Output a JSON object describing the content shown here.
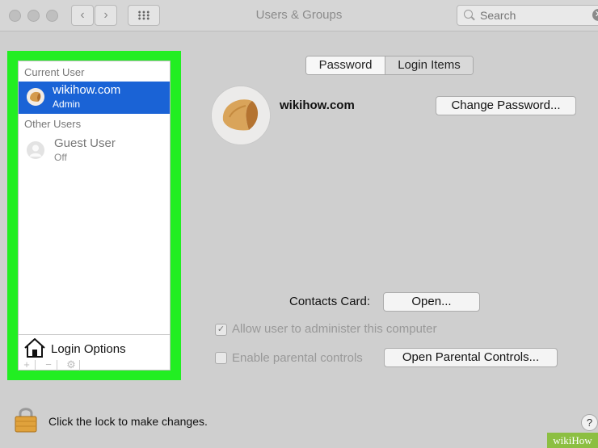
{
  "window": {
    "title": "Users & Groups"
  },
  "toolbar": {
    "back_glyph": "‹",
    "forward_glyph": "›",
    "grid_icon": "show-all-icon"
  },
  "search": {
    "placeholder": "Search",
    "clear_glyph": "✕"
  },
  "sidebar": {
    "current_heading": "Current User",
    "current_user": {
      "name": "wikihow.com",
      "role": "Admin"
    },
    "other_heading": "Other Users",
    "guest_user": {
      "name": "Guest User",
      "status": "Off"
    },
    "login_options_label": "Login Options",
    "tools": {
      "add": "+",
      "remove": "−",
      "gear": "⚙"
    },
    "highlight_color": "#22ee22"
  },
  "tabs": {
    "password": "Password",
    "login_items": "Login Items",
    "selected": "Login Items"
  },
  "account": {
    "name": "wikihow.com",
    "change_password_label": "Change Password...",
    "contacts_label": "Contacts Card:",
    "open_label": "Open...",
    "admin_checkbox_label": "Allow user to administer this computer",
    "admin_checked": true,
    "parental_checkbox_label": "Enable parental controls",
    "parental_checked": false,
    "open_parental_label": "Open Parental Controls..."
  },
  "footer": {
    "lock_text": "Click the lock to make changes.",
    "help_label": "?"
  },
  "watermark": {
    "text": "wikiHow"
  },
  "colors": {
    "selection": "#1a63d6",
    "highlight": "#22ee22",
    "watermark_bg": "#8cbf42"
  }
}
